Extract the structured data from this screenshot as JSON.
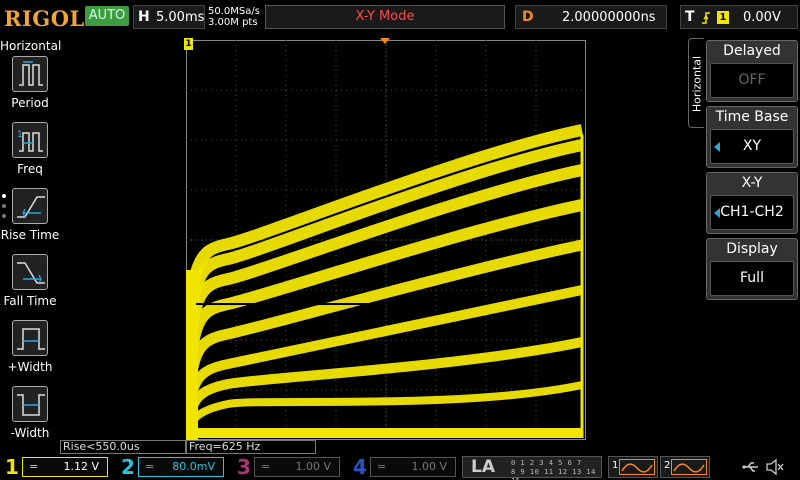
{
  "header": {
    "logo": "RIGOL",
    "run_mode": "AUTO",
    "timebase_label": "H",
    "timebase_value": "5.00ms",
    "sample_rate": "50.0MSa/s",
    "memory_depth": "3.00M pts",
    "mode": "X-Y Mode",
    "delay_label": "D",
    "delay_value": "2.00000000ns",
    "trigger_label": "T",
    "trigger_channel": "1",
    "trigger_level": "0.00V"
  },
  "left_panel": {
    "title": "Horizontal",
    "items": [
      {
        "label": "Period",
        "icon": "period-icon"
      },
      {
        "label": "Freq",
        "icon": "freq-icon"
      },
      {
        "label": "Rise Time",
        "icon": "rise-time-icon"
      },
      {
        "label": "Fall Time",
        "icon": "fall-time-icon"
      },
      {
        "label": "+Width",
        "icon": "pos-width-icon"
      },
      {
        "label": "-Width",
        "icon": "neg-width-icon"
      }
    ]
  },
  "display": {
    "trigger_marker": "1",
    "measurements": [
      {
        "text": "Rise<550.0us"
      },
      {
        "text": "Freq=625 Hz"
      }
    ]
  },
  "right_menu": {
    "tab_label": "Horizontal",
    "items": [
      {
        "title": "Delayed",
        "value": "OFF",
        "enabled": false
      },
      {
        "title": "Time Base",
        "value": "XY",
        "enabled": true
      },
      {
        "title": "X-Y",
        "value": "CH1-CH2",
        "enabled": true
      },
      {
        "title": "Display",
        "value": "Full",
        "enabled": true
      }
    ]
  },
  "channels": [
    {
      "num": "1",
      "value": "1.12 V",
      "color": "#f2e600",
      "active": true
    },
    {
      "num": "2",
      "value": "80.0mV",
      "color": "#22c6e0",
      "active": true
    },
    {
      "num": "3",
      "value": "1.00 V",
      "color": "#b0307a",
      "active": false
    },
    {
      "num": "4",
      "value": "1.00 V",
      "color": "#2a55c8",
      "active": false
    }
  ],
  "logic_analyzer": {
    "label": "LA",
    "row1": "0 1 2 3 4 5 6 7",
    "row2": "8 9 10 11 12 13 14 15"
  },
  "generators": [
    {
      "num": "1"
    },
    {
      "num": "2"
    }
  ],
  "colors": {
    "trace": "#f2e600",
    "accent": "#f28a1e",
    "grid": "#4a4a4a",
    "mode_text": "#ff4b4b",
    "logo": "#f2a33a"
  }
}
